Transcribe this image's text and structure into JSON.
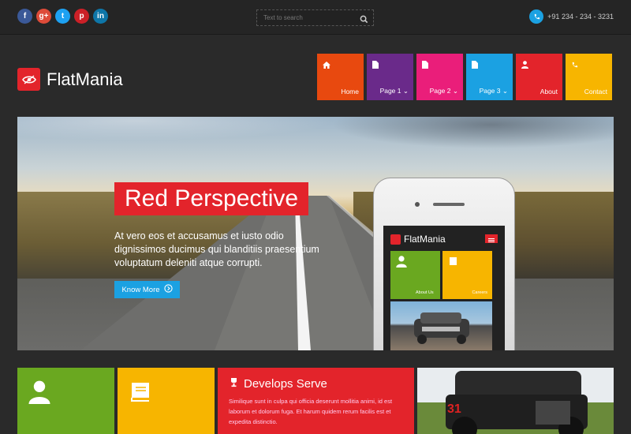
{
  "header": {
    "social": [
      {
        "name": "facebook",
        "glyph": "f",
        "color": "#3b5998"
      },
      {
        "name": "google-plus",
        "glyph": "g+",
        "color": "#dd4b39"
      },
      {
        "name": "twitter",
        "glyph": "t",
        "color": "#1da1f2"
      },
      {
        "name": "pinterest",
        "glyph": "p",
        "color": "#cb2027"
      },
      {
        "name": "linkedin",
        "glyph": "in",
        "color": "#0e76a8"
      }
    ],
    "search": {
      "placeholder": "Text to search"
    },
    "phone": "+91 234 - 234 - 3231"
  },
  "brand": {
    "name": "FlatMania"
  },
  "nav": [
    {
      "label": "Home",
      "color": "#e8490f",
      "icon": "home-icon"
    },
    {
      "label": "Page 1 ⌄",
      "color": "#6a2a8a",
      "icon": "page-icon"
    },
    {
      "label": "Page 2 ⌄",
      "color": "#ea1e7a",
      "icon": "page-icon"
    },
    {
      "label": "Page 3 ⌄",
      "color": "#1ba1e2",
      "icon": "page-icon"
    },
    {
      "label": "About",
      "color": "#e3242b",
      "icon": "user-icon"
    },
    {
      "label": "Contact",
      "color": "#f7b500",
      "icon": "phone-icon"
    }
  ],
  "hero": {
    "title": "Red Perspective",
    "text": "At vero eos et accusamus et iusto odio dignissimos ducimus qui blanditiis praesentium voluptatum deleniti atque corrupti.",
    "button": "Know More"
  },
  "mobile": {
    "brand": "FlatMania",
    "tiles": [
      {
        "label": "About Us",
        "color": "#6aa820"
      },
      {
        "label": "Careers",
        "color": "#f7b500"
      }
    ]
  },
  "cards": {
    "card1_color": "#6aa820",
    "card2_color": "#f7b500",
    "develops": {
      "title": "Develops Serve",
      "text": "Similique sunt in culpa qui officia deserunt mollitia animi, id est laborum et dolorum fuga. Et harum quidem rerum facilis est et expedita distinctio."
    },
    "car_number": "31"
  }
}
